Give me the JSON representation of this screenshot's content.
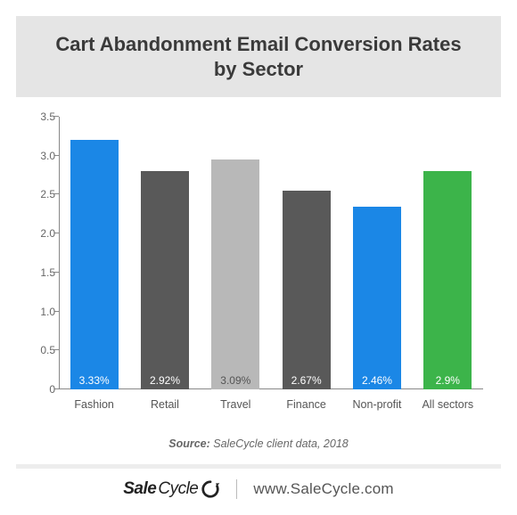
{
  "title": "Cart Abandonment Email Conversion Rates by Sector",
  "source_label": "Source:",
  "source_text": " SaleCycle client data, 2018",
  "brand_part1": "Sale",
  "brand_part2": "Cycle",
  "url": "www.SaleCycle.com",
  "chart_data": {
    "type": "bar",
    "title": "Cart Abandonment Email Conversion Rates by Sector",
    "xlabel": "",
    "ylabel": "",
    "ylim": [
      0,
      3.5
    ],
    "yticks": [
      0,
      0.5,
      1.0,
      1.5,
      2.0,
      2.5,
      3.0,
      3.5
    ],
    "ytick_labels": [
      "0",
      "0.5",
      "1.0",
      "1.5",
      "2.0",
      "2.5",
      "3.0",
      "3.5"
    ],
    "categories": [
      "Fashion",
      "Retail",
      "Travel",
      "Finance",
      "Non-profit",
      "All sectors"
    ],
    "values": [
      3.33,
      2.92,
      3.09,
      2.67,
      2.46,
      2.9
    ],
    "value_labels": [
      "3.33%",
      "2.92%",
      "3.09%",
      "2.67%",
      "2.46%",
      "2.9%"
    ],
    "bar_colors": [
      "#1b87e6",
      "#595959",
      "#b8b8b8",
      "#595959",
      "#1b87e6",
      "#3cb44a"
    ],
    "visual_heights": [
      3.2,
      2.8,
      2.95,
      2.55,
      2.35,
      2.8
    ],
    "label_dark": [
      false,
      false,
      true,
      false,
      false,
      false
    ]
  }
}
